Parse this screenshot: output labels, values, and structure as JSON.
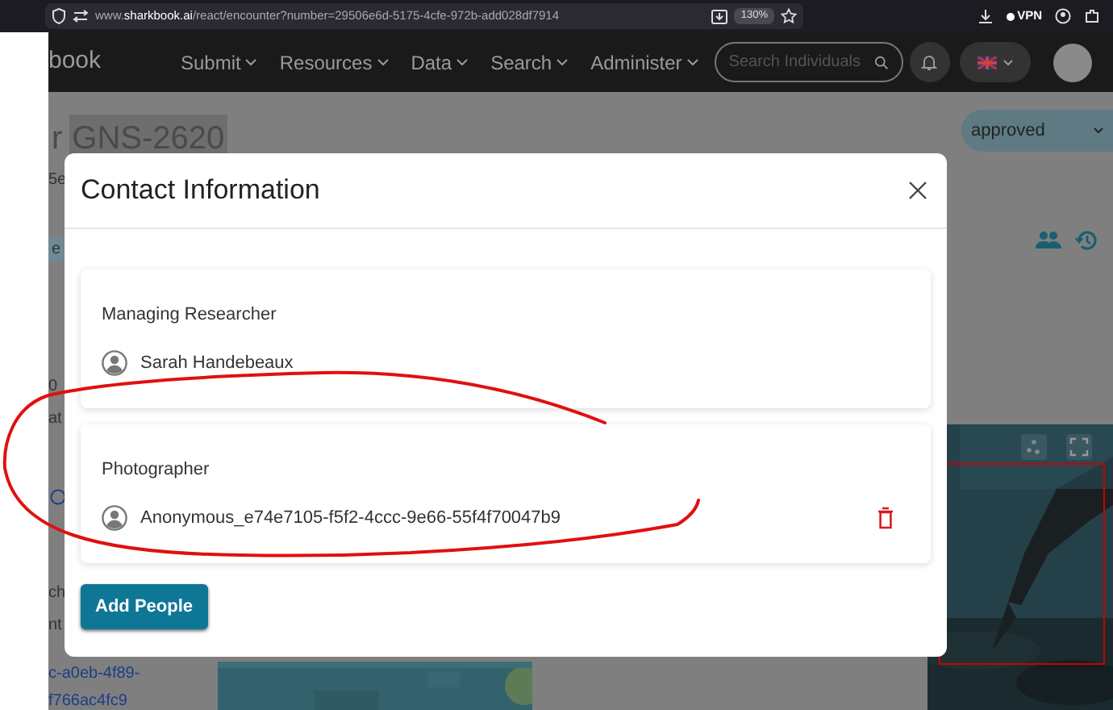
{
  "browser": {
    "url": "www.**sharkbook.ai**/react/encounter?number=29506e6d-5175-4cfe-972b-add028df7914",
    "zoom": "130%",
    "vpn": "VPN"
  },
  "nav": {
    "brand": "book",
    "menu": [
      "Submit",
      "Resources",
      "Data",
      "Search",
      "Administer"
    ],
    "search": {
      "placeholder": "Search Individuals"
    }
  },
  "page": {
    "title_prefix": "r",
    "title_id": "GNS-2620",
    "status": "approved",
    "fragments": [
      {
        "text": "5e",
        "kind": "plain"
      },
      {
        "text": "e",
        "kind": "chip"
      },
      {
        "text": "0",
        "kind": "plain"
      },
      {
        "text": "at",
        "kind": "plain"
      },
      {
        "text": "ch",
        "kind": "plain"
      },
      {
        "text": "nt",
        "kind": "plain"
      },
      {
        "text": "c-a0eb-4f89-",
        "kind": "link"
      },
      {
        "text": "f766ac4fc9",
        "kind": "link"
      }
    ]
  },
  "modal": {
    "title": "Contact Information",
    "sections": [
      {
        "heading": "Managing Researcher",
        "name": "Sarah Handebeaux",
        "deletable": false
      },
      {
        "heading": "Photographer",
        "name": "Anonymous_e74e7105-f5f2-4ccc-9e66-55f4f70047b9",
        "deletable": true
      }
    ],
    "button": "Add People"
  }
}
